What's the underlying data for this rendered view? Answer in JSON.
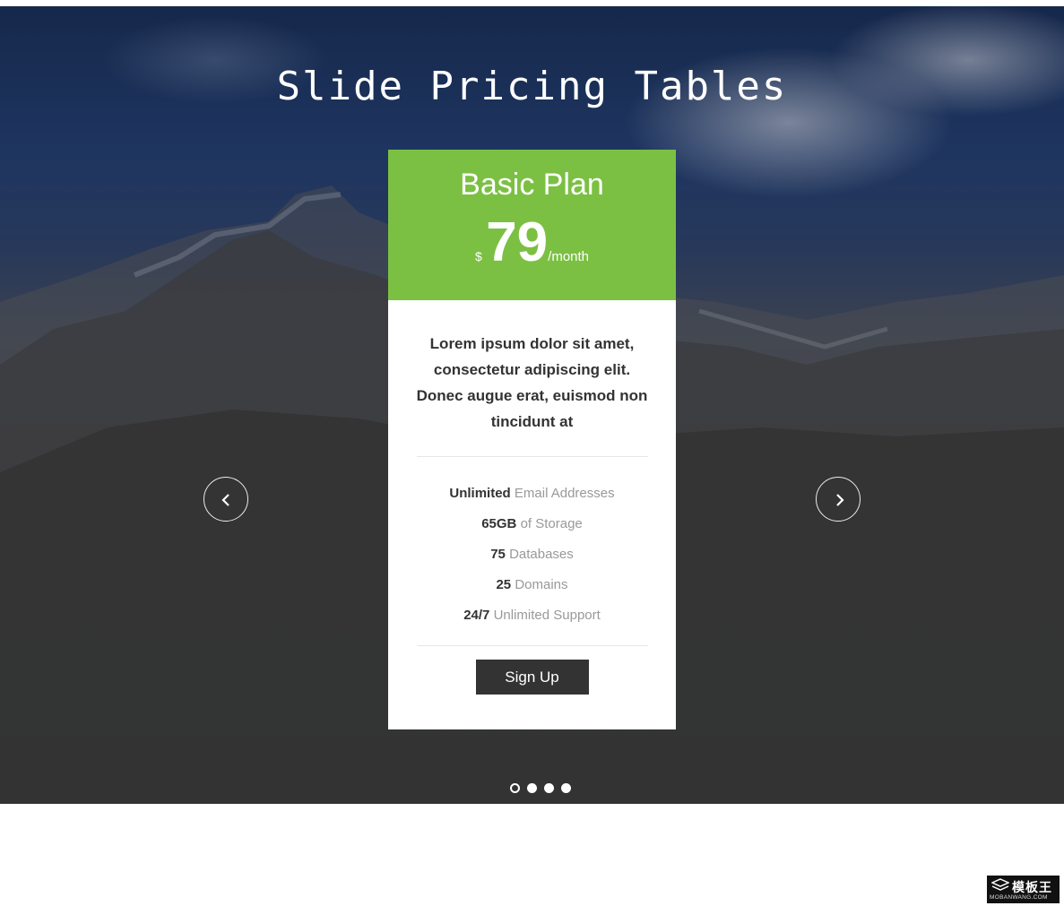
{
  "hero": {
    "title": "Slide Pricing Tables"
  },
  "pricing_card": {
    "plan_name": "Basic Plan",
    "currency": "$",
    "amount": "79",
    "period": "/month",
    "description": "Lorem ipsum dolor sit amet, consectetur adipiscing elit. Donec augue erat, euismod non tincidunt at",
    "features": [
      {
        "strong": "Unlimited",
        "text": "Email Addresses"
      },
      {
        "strong": "65GB",
        "text": "of Storage"
      },
      {
        "strong": "75",
        "text": "Databases"
      },
      {
        "strong": "25",
        "text": "Domains"
      },
      {
        "strong": "24/7",
        "text": "Unlimited Support"
      }
    ],
    "signup_label": "Sign Up",
    "accent_color": "#7bc043"
  },
  "navigation": {
    "prev_icon": "chevron-left-icon",
    "next_icon": "chevron-right-icon"
  },
  "pagination": {
    "total": 4,
    "active_index": 0
  },
  "watermark": {
    "name": "模板王",
    "site": "MOBANWANG.COM"
  }
}
